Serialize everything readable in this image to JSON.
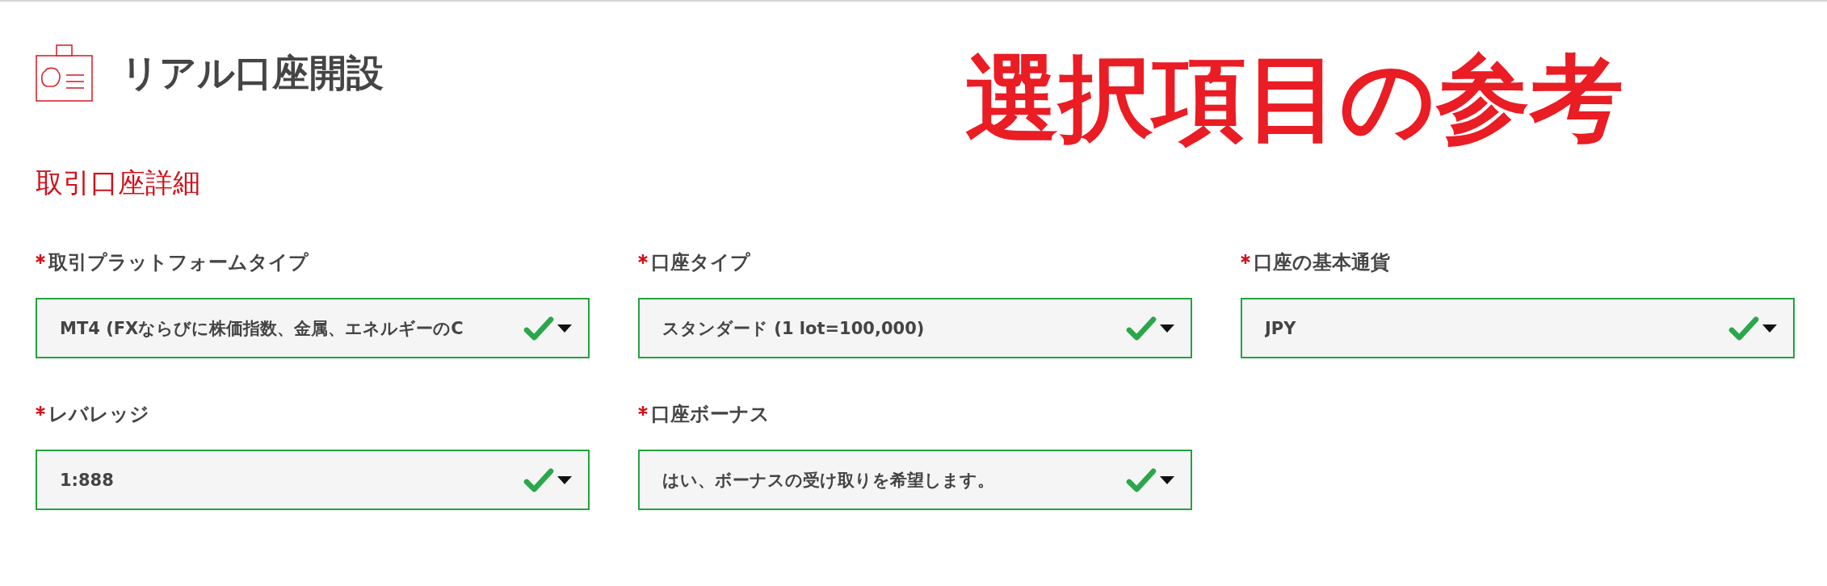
{
  "page": {
    "title": "リアル口座開設",
    "annotation": "選択項目の参考"
  },
  "section": {
    "heading": "取引口座詳細"
  },
  "fields": [
    {
      "label": "取引プラットフォームタイプ",
      "required": true,
      "value": "MT4 (FXならびに株価指数、金属、エネルギーのC",
      "valid": true
    },
    {
      "label": "口座タイプ",
      "required": true,
      "value": "スタンダード (1 lot=100,000)",
      "valid": true
    },
    {
      "label": "口座の基本通貨",
      "required": true,
      "value": "JPY",
      "valid": true
    },
    {
      "label": "レバレッジ",
      "required": true,
      "value": "1:888",
      "valid": true
    },
    {
      "label": "口座ボーナス",
      "required": true,
      "value": "はい、ボーナスの受け取りを希望します。",
      "valid": true
    }
  ]
}
